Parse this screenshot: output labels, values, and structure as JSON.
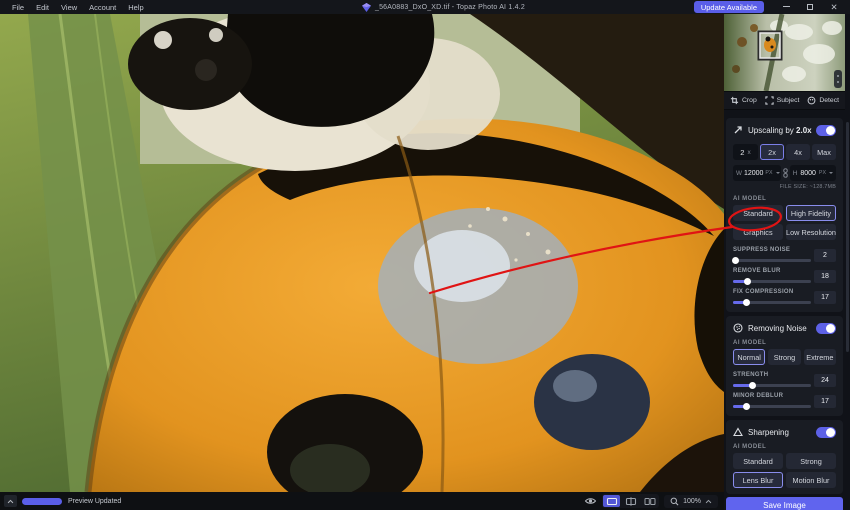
{
  "titlebar": {
    "menus": [
      "File",
      "Edit",
      "View",
      "Account",
      "Help"
    ],
    "title": "_56A0883_DxO_XD.tif - Topaz Photo AI 1.4.2",
    "update_button": "Update Available",
    "window": {
      "close": "✕"
    }
  },
  "toolbar": {
    "crop": "Crop",
    "subject": "Subject",
    "detect": "Detect"
  },
  "upscaling": {
    "heading_prefix": "Upscaling by",
    "heading_scale": "2.0x",
    "enabled": true,
    "custom_scale": "2",
    "multiply_label": "x",
    "scale_options": [
      "2x",
      "4x",
      "Max"
    ],
    "selected_scale": "2x",
    "width_label": "W",
    "width_value": "12000",
    "width_unit": "PX",
    "height_label": "H",
    "height_value": "8000",
    "height_unit": "PX",
    "file_size": "FILE SIZE: ~128.7MB",
    "ai_model_label": "AI MODEL",
    "models": [
      "Standard",
      "High Fidelity",
      "Graphics",
      "Low Resolution"
    ],
    "selected_model": "High Fidelity",
    "sliders": [
      {
        "label": "SUPPRESS NOISE",
        "value": 2
      },
      {
        "label": "REMOVE BLUR",
        "value": 18
      },
      {
        "label": "FIX COMPRESSION",
        "value": 17
      }
    ]
  },
  "removing_noise": {
    "title": "Removing Noise",
    "enabled": true,
    "ai_model_label": "AI MODEL",
    "models": [
      "Normal",
      "Strong",
      "Extreme"
    ],
    "selected_model": "Normal",
    "sliders": [
      {
        "label": "STRENGTH",
        "value": 24
      },
      {
        "label": "MINOR DEBLUR",
        "value": 17
      }
    ]
  },
  "sharpening": {
    "title": "Sharpening",
    "enabled": true,
    "ai_model_label": "AI MODEL",
    "models": [
      "Standard",
      "Strong",
      "Lens Blur",
      "Motion Blur"
    ],
    "selected_model": "Lens Blur"
  },
  "save_button": "Save Image",
  "statusbar": {
    "preview_status": "Preview Updated",
    "zoom_level": "100%"
  },
  "colors": {
    "accent": "#5d61e6",
    "annotation": "#e01414",
    "save_button": "#6064ee"
  }
}
